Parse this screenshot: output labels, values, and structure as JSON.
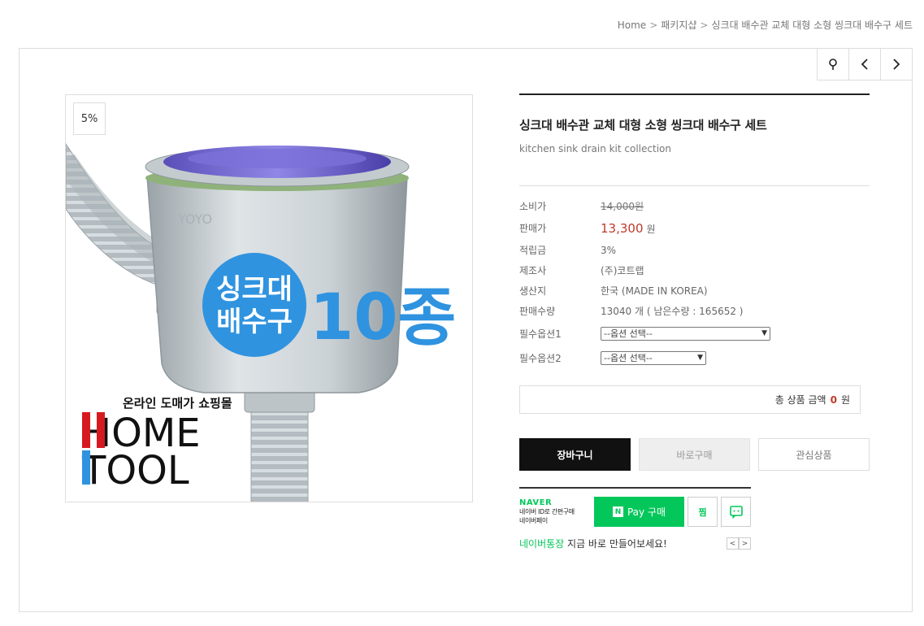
{
  "breadcrumb": {
    "home": "Home",
    "category": "패키지샵",
    "current": "싱크대 배수관 교체 대형 소형 씽크대 배수구 세트",
    "separator": ">"
  },
  "nav": {
    "search_icon": "search-pin-icon",
    "prev_icon": "chevron-left-icon",
    "next_icon": "chevron-right-icon"
  },
  "image": {
    "discount_badge": "5%",
    "banner_text_1": "싱크대",
    "banner_text_2": "배수구",
    "banner_count": "10종",
    "shop_tagline": "온라인 도매가 쇼핑몰",
    "logo_line1": "HOME",
    "logo_line2": "TOOL",
    "product_brand": "YOYO"
  },
  "product": {
    "title": "싱크대 배수관 교체 대형 소형 씽크대 배수구 세트",
    "subtitle": "kitchen sink drain kit collection"
  },
  "specs": {
    "retail_label": "소비가",
    "retail_value": "14,000원",
    "sale_label": "판매가",
    "sale_value": "13,300",
    "sale_unit": "원",
    "points_label": "적립금",
    "points_value": "3%",
    "maker_label": "제조사",
    "maker_value": "(주)코트랩",
    "origin_label": "생산지",
    "origin_value": "한국 (MADE IN KOREA)",
    "sold_label": "판매수량",
    "sold_value": "13040 개 ( 남은수량 : 165652 )",
    "option1_label": "필수옵션1",
    "option1_value": "--옵션 선택--",
    "option2_label": "필수옵션2",
    "option2_value": "--옵션 선택--"
  },
  "total": {
    "label": "총 상품 금액",
    "value": "0",
    "unit": "원"
  },
  "buttons": {
    "cart": "장바구니",
    "buy_now": "바로구매",
    "wishlist": "관심상품"
  },
  "naver": {
    "brand": "NAVER",
    "desc_line1": "네이버 ID로 간편구매",
    "desc_line2": "네이버페이",
    "pay_n": "N",
    "pay_label": "Pay 구매",
    "zzim": "찜",
    "bank_label": "네이버통장",
    "bank_text": "지금 바로 만들어보세요!",
    "prev": "<",
    "next": ">"
  },
  "colors": {
    "accent_red": "#c0392b",
    "naver_green": "#03c75a",
    "banner_blue": "#2f93e0",
    "logo_red": "#d71920"
  }
}
